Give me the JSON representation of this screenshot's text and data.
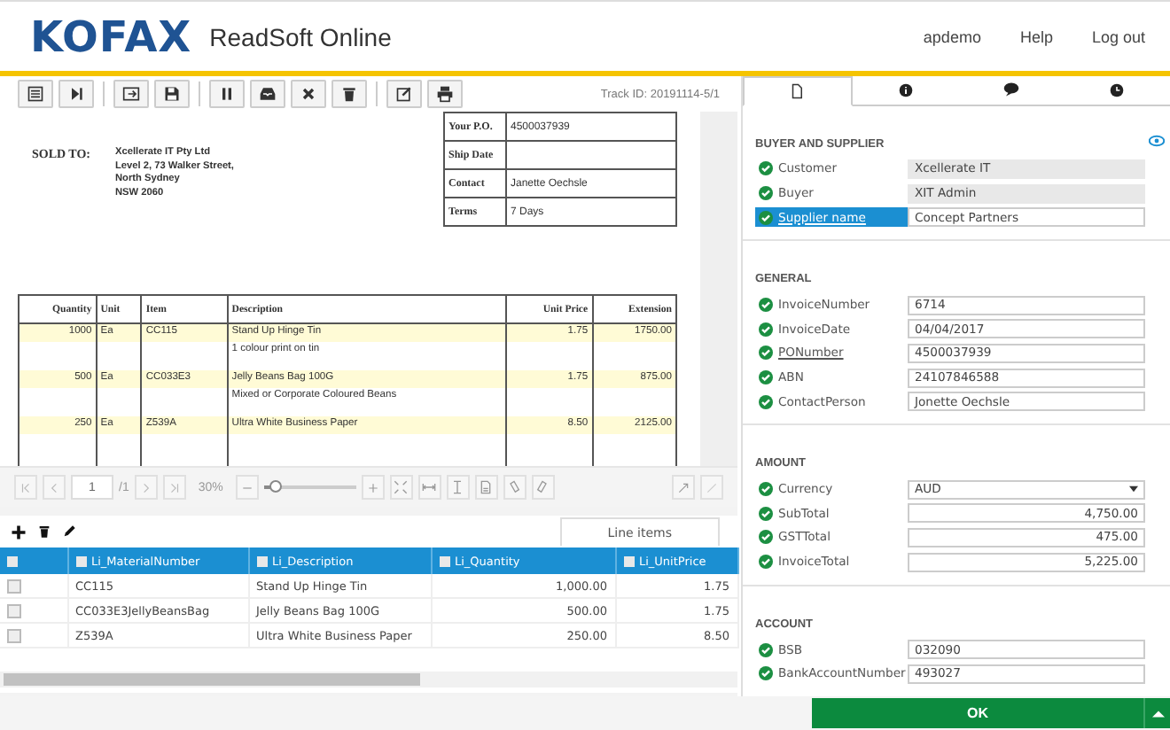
{
  "header": {
    "logo": "KOFAX",
    "app_title": "ReadSoft Online",
    "nav": [
      "apdemo",
      "Help",
      "Log out"
    ]
  },
  "toolbar": {
    "track_id": "Track ID: 20191114-5/1"
  },
  "document": {
    "sold_to_label": "SOLD TO:",
    "sold_to_lines": [
      "Xcellerate IT Pty Ltd",
      "Level 2, 73 Walker Street,",
      "North Sydney",
      "NSW 2060"
    ],
    "po_table": [
      {
        "label": "Your P.O.",
        "value": "4500037939"
      },
      {
        "label": "Ship Date"
      },
      {
        "label": "Contact",
        "value": "Janette Oechsle"
      },
      {
        "label": "Terms",
        "value": "7 Days"
      }
    ],
    "line_table": {
      "columns": [
        "Quantity",
        "Unit",
        "Item",
        "Description",
        "Unit Price",
        "Extension"
      ],
      "rows": [
        {
          "quantity": "1000",
          "unit": "Ea",
          "item": "CC115",
          "description": "Stand Up Hinge Tin",
          "note": "1 colour print on tin",
          "unit_price": "1.75",
          "extension": "1750.00",
          "highlighted": true
        },
        {
          "quantity": "500",
          "unit": "Ea",
          "item": "CC033E3",
          "description": "Jelly Beans Bag 100G",
          "note": "Mixed or Corporate Coloured Beans",
          "unit_price": "1.75",
          "extension": "875.00",
          "highlighted": true
        },
        {
          "quantity": "250",
          "unit": "Ea",
          "item": "Z539A",
          "description": "Ultra White Business Paper",
          "unit_price": "8.50",
          "extension": "2125.00",
          "highlighted": true
        }
      ]
    }
  },
  "viewer_toolbar": {
    "page": "1",
    "page_total": "/1",
    "zoom": "30%",
    "zoom_slider": {
      "level": 0.12
    }
  },
  "line_items": {
    "tab": "Line items",
    "select_all": {
      "checked": false
    },
    "columns": [
      {
        "label": "Li_MaterialNumber",
        "checked": false
      },
      {
        "label": "Li_Description",
        "checked": false
      },
      {
        "label": "Li_Quantity",
        "checked": false
      },
      {
        "label": "Li_UnitPrice",
        "checked": false
      }
    ],
    "rows": [
      {
        "checked": false,
        "cells": [
          "CC115",
          "Stand Up Hinge Tin",
          "1,000.00",
          "1.75"
        ]
      },
      {
        "checked": false,
        "cells": [
          "CC033E3JellyBeansBag",
          "Jelly Beans Bag 100G",
          "500.00",
          "1.75"
        ]
      },
      {
        "checked": false,
        "cells": [
          "Z539A",
          "Ultra White Business Paper",
          "250.00",
          "8.50"
        ]
      }
    ]
  },
  "panel_tabs": [
    {
      "kind": "document",
      "selected": true
    },
    {
      "kind": "info",
      "selected": false
    },
    {
      "kind": "comments",
      "selected": false
    },
    {
      "kind": "history",
      "selected": false
    }
  ],
  "sections": [
    {
      "title": "BUYER AND SUPPLIER",
      "fields": [
        {
          "label": "Customer",
          "value": "Xcellerate IT",
          "kind": "text",
          "readonly": true,
          "linked": false,
          "selected": false,
          "valid": true
        },
        {
          "label": "Buyer",
          "value": "XIT Admin",
          "kind": "text",
          "readonly": true,
          "linked": false,
          "selected": false,
          "valid": true
        },
        {
          "label": "Supplier name",
          "value": "Concept Partners",
          "kind": "text",
          "readonly": false,
          "linked": true,
          "selected": true,
          "valid": true
        }
      ]
    },
    {
      "title": "GENERAL",
      "fields": [
        {
          "label": "InvoiceNumber",
          "value": "6714",
          "kind": "text",
          "readonly": false,
          "linked": false,
          "selected": false,
          "valid": true
        },
        {
          "label": "InvoiceDate",
          "value": "04/04/2017",
          "kind": "text",
          "readonly": false,
          "linked": false,
          "selected": false,
          "valid": true
        },
        {
          "label": "PONumber",
          "value": "4500037939",
          "kind": "text",
          "readonly": false,
          "linked": true,
          "selected": false,
          "valid": true
        },
        {
          "label": "ABN",
          "value": "24107846588",
          "kind": "text",
          "readonly": false,
          "linked": false,
          "selected": false,
          "valid": true
        },
        {
          "label": "ContactPerson",
          "value": "Jonette Oechsle",
          "kind": "text",
          "readonly": false,
          "linked": false,
          "selected": false,
          "valid": true
        }
      ]
    },
    {
      "title": "AMOUNT",
      "fields": [
        {
          "label": "Currency",
          "value": "AUD",
          "kind": "select",
          "readonly": false,
          "linked": false,
          "selected": false,
          "valid": true
        },
        {
          "label": "SubTotal",
          "value": "4,750.00",
          "kind": "number",
          "readonly": false,
          "linked": false,
          "selected": false,
          "valid": true
        },
        {
          "label": "GSTTotal",
          "value": "475.00",
          "kind": "number",
          "readonly": false,
          "linked": false,
          "selected": false,
          "valid": true
        },
        {
          "label": "InvoiceTotal",
          "value": "5,225.00",
          "kind": "number",
          "readonly": false,
          "linked": false,
          "selected": false,
          "valid": true
        }
      ]
    },
    {
      "title": "ACCOUNT",
      "fields": [
        {
          "label": "BSB",
          "value": "032090",
          "kind": "text",
          "readonly": false,
          "linked": false,
          "selected": false,
          "valid": true
        },
        {
          "label": "BankAccountNumber",
          "value": "493027",
          "kind": "text",
          "readonly": false,
          "linked": false,
          "selected": false,
          "valid": true
        }
      ]
    }
  ],
  "ok_button": "OK"
}
